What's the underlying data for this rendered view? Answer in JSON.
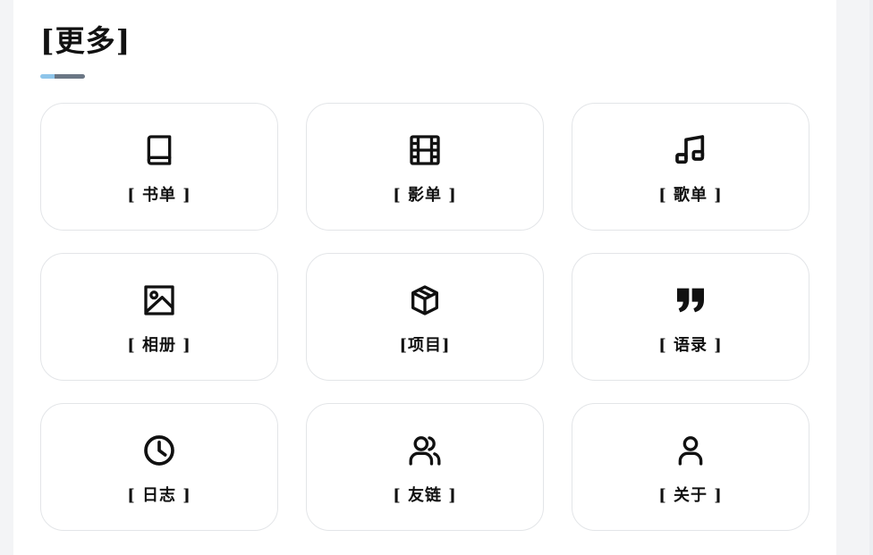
{
  "section": {
    "title": "[更多]"
  },
  "colors": {
    "page_bg": "#f3f4f6",
    "panel_bg": "#ffffff",
    "card_border": "#e3e5e8",
    "accent_light": "#8ec5ea",
    "accent_dark": "#6b7785"
  },
  "menu": {
    "items": [
      {
        "label": "[ 书单 ]",
        "icon": "book-icon"
      },
      {
        "label": "[ 影单 ]",
        "icon": "film-icon"
      },
      {
        "label": "[ 歌单 ]",
        "icon": "music-note-icon"
      },
      {
        "label": "[ 相册 ]",
        "icon": "image-icon"
      },
      {
        "label": "[项目]",
        "icon": "package-box-icon"
      },
      {
        "label": "[ 语录 ]",
        "icon": "quote-icon"
      },
      {
        "label": "[ 日志 ]",
        "icon": "clock-icon"
      },
      {
        "label": "[ 友链 ]",
        "icon": "users-icon"
      },
      {
        "label": "[ 关于 ]",
        "icon": "user-icon"
      }
    ]
  }
}
